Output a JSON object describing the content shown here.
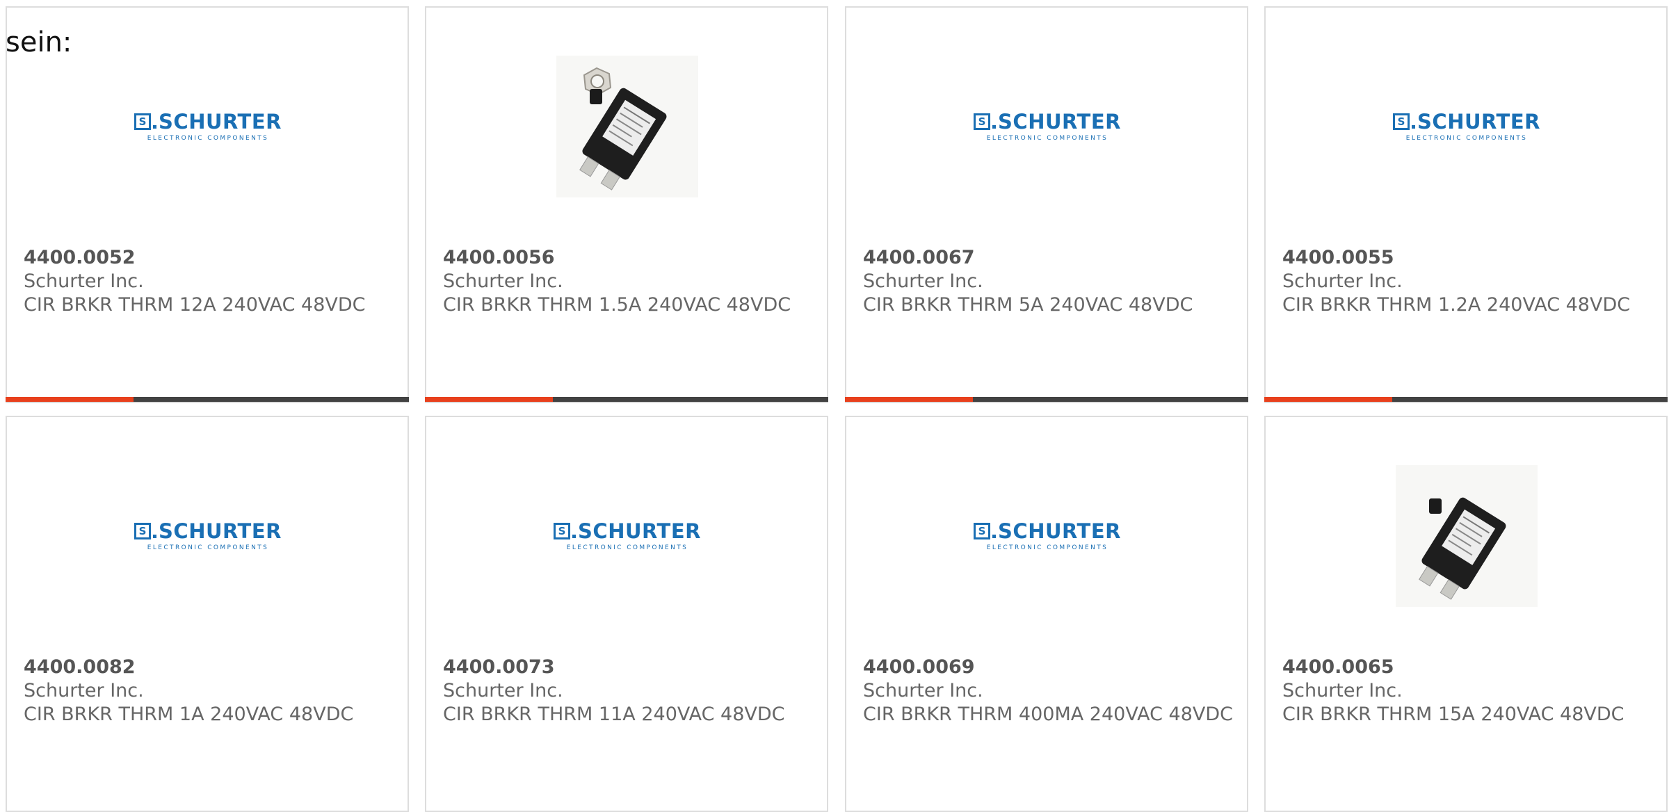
{
  "intro_text": "sein:",
  "colors": {
    "bar_accent": "#e8401c",
    "bar_dark": "#424242",
    "logo_blue": "#1a6fb4"
  },
  "logo": {
    "word": "SCHURTER",
    "mark": "S",
    "sub": "ELECTRONIC COMPONENTS"
  },
  "products": [
    {
      "part": "4400.0052",
      "mfr": "Schurter Inc.",
      "desc": "CIR BRKR THRM 12A 240VAC 48VDC",
      "image": "schurter-logo"
    },
    {
      "part": "4400.0056",
      "mfr": "Schurter Inc.",
      "desc": "CIR BRKR THRM 1.5A 240VAC 48VDC",
      "image": "breaker-photo-with-nut"
    },
    {
      "part": "4400.0067",
      "mfr": "Schurter Inc.",
      "desc": "CIR BRKR THRM 5A 240VAC 48VDC",
      "image": "schurter-logo"
    },
    {
      "part": "4400.0055",
      "mfr": "Schurter Inc.",
      "desc": "CIR BRKR THRM 1.2A 240VAC 48VDC",
      "image": "schurter-logo"
    },
    {
      "part": "4400.0082",
      "mfr": "Schurter Inc.",
      "desc": "CIR BRKR THRM 1A 240VAC 48VDC",
      "image": "schurter-logo"
    },
    {
      "part": "4400.0073",
      "mfr": "Schurter Inc.",
      "desc": "CIR BRKR THRM 11A 240VAC 48VDC",
      "image": "schurter-logo"
    },
    {
      "part": "4400.0069",
      "mfr": "Schurter Inc.",
      "desc": "CIR BRKR THRM 400MA 240VAC 48VDC",
      "image": "schurter-logo"
    },
    {
      "part": "4400.0065",
      "mfr": "Schurter Inc.",
      "desc": "CIR BRKR THRM 15A 240VAC 48VDC",
      "image": "breaker-photo"
    }
  ]
}
